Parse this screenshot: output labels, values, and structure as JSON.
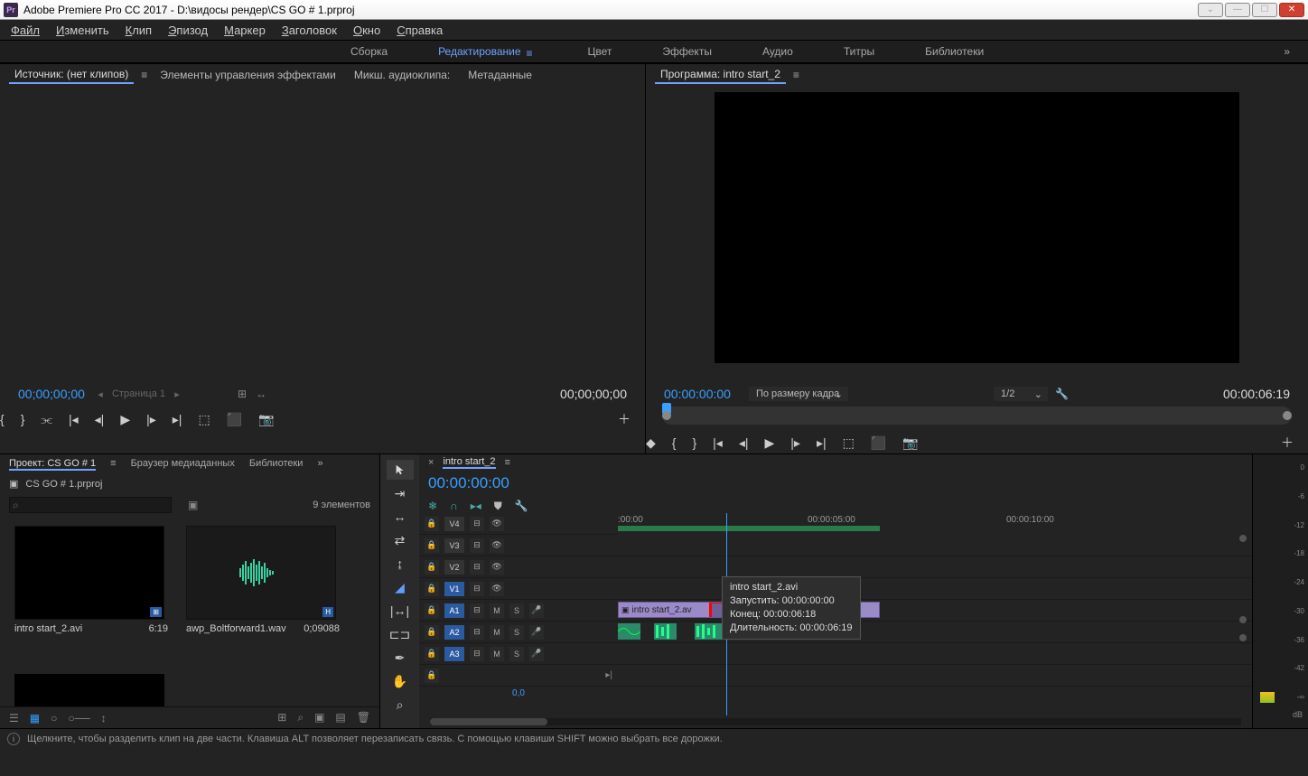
{
  "titlebar": {
    "app": "Adobe Premiere Pro CC 2017",
    "sep": " - ",
    "path": "D:\\видосы рендер\\CS GO # 1.prproj"
  },
  "menu": [
    "Файл",
    "Изменить",
    "Клип",
    "Эпизод",
    "Маркер",
    "Заголовок",
    "Окно",
    "Справка"
  ],
  "workspaces": {
    "items": [
      "Сборка",
      "Редактирование",
      "Цвет",
      "Эффекты",
      "Аудио",
      "Титры",
      "Библиотеки"
    ],
    "active": 1
  },
  "source": {
    "tabs": [
      "Источник: (нет клипов)",
      "Элементы управления эффектами",
      "Микш. аудиоклипа:",
      "Метаданные"
    ],
    "tc_left": "00;00;00;00",
    "pager_label": "Страница 1",
    "tc_right": "00;00;00;00"
  },
  "program": {
    "title": "Программа: intro start_2",
    "tc_left": "00:00:00:00",
    "fit": "По размеру кадра",
    "half": "1/2",
    "tc_right": "00:00:06:19"
  },
  "project": {
    "tabs": [
      "Проект: CS GO # 1",
      "Браузер медиаданных",
      "Библиотеки"
    ],
    "file": "CS GO # 1.prproj",
    "count": "9 элементов",
    "items": [
      {
        "name": "intro start_2.avi",
        "dur": "6:19"
      },
      {
        "name": "awp_Boltforward1.wav",
        "dur": "0;09088"
      }
    ]
  },
  "timeline": {
    "seq": "intro start_2",
    "tc": "00:00:00:00",
    "ruler": [
      ":00:00",
      "00:00:05:00",
      "00:00:10:00"
    ],
    "tracks_v": [
      "V4",
      "V3",
      "V2",
      "V1"
    ],
    "tracks_a": [
      "A1",
      "A2",
      "A3"
    ],
    "clip_v1": "intro start_2.av",
    "zoom": "0,0",
    "tooltip": {
      "name": "intro start_2.avi",
      "start_lbl": "Запустить:",
      "start": "00:00:00:00",
      "end_lbl": "Конец:",
      "end": "00:00:06:18",
      "dur_lbl": "Длительность:",
      "dur": "00:00:06:19"
    }
  },
  "meters": {
    "scale": [
      "0",
      "-6",
      "-12",
      "-18",
      "-24",
      "-30",
      "-36",
      "-42",
      "-∞"
    ],
    "unit": "dB"
  },
  "status": "Щелкните, чтобы разделить клип на две части. Клавиша ALT позволяет перезаписать связь. С помощью клавиши SHIFT можно выбрать все дорожки."
}
